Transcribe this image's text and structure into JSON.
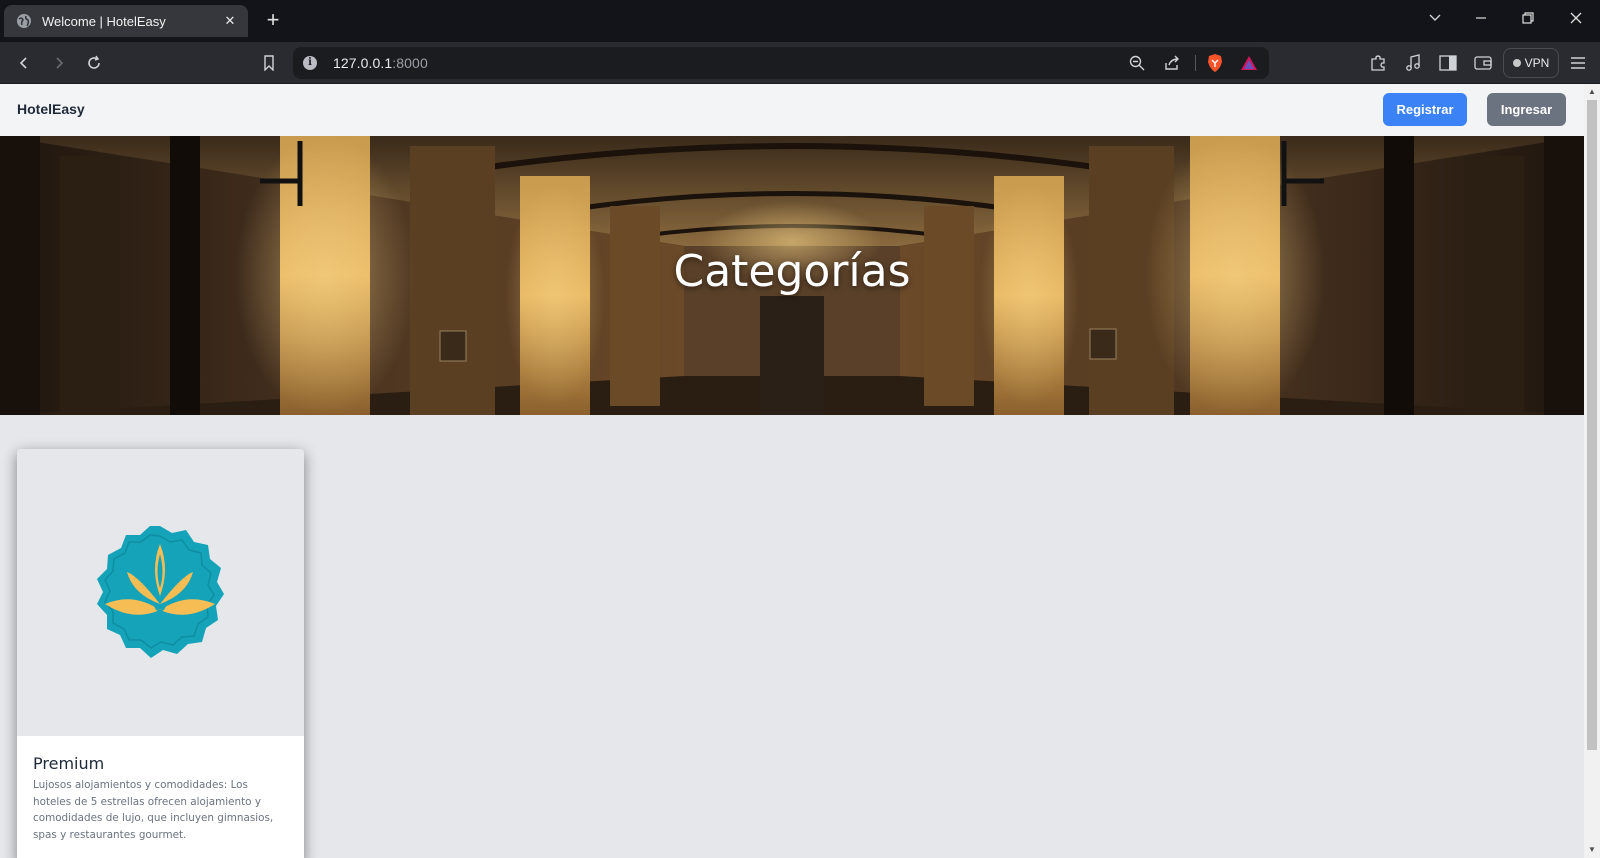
{
  "browser": {
    "tab_title": "Welcome | HotelEasy",
    "url_host": "127.0.0.1",
    "url_port": ":8000",
    "vpn_label": "VPN"
  },
  "navbar": {
    "brand": "HotelEasy",
    "register_label": "Registrar",
    "login_label": "Ingresar",
    "register_color": "#3b82f6",
    "login_color": "#6b7280"
  },
  "hero": {
    "title": "Categorías"
  },
  "categories": [
    {
      "name": "Premium",
      "description": "Lujosos alojamientos y comodidades: Los hoteles de 5 estrellas ofrecen alojamiento y comodidades de lujo, que incluyen gimnasios, spas y restaurantes gourmet.",
      "icon": "lotus-badge-icon",
      "badge_color": "#14a3b8",
      "lotus_color": "#f6bd55"
    }
  ]
}
